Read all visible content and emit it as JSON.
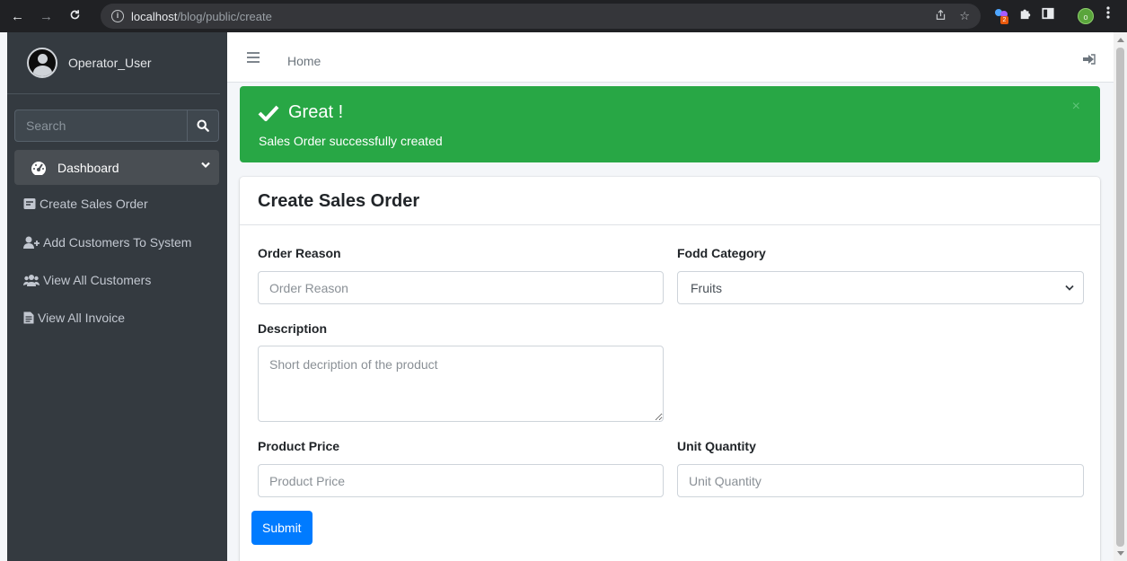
{
  "browser": {
    "url_host": "localhost",
    "url_path": "/blog/public/create",
    "extension_badge": "2",
    "profile_initial": "o"
  },
  "sidebar": {
    "user_name": "Operator_User",
    "search_placeholder": "Search",
    "dashboard_label": "Dashboard",
    "items": [
      {
        "label": "Create Sales Order",
        "icon": "form-icon"
      },
      {
        "label": "Add Customers To System",
        "icon": "user-plus-icon"
      },
      {
        "label": "View All Customers",
        "icon": "users-icon"
      },
      {
        "label": "View All Invoice",
        "icon": "file-invoice-icon"
      }
    ]
  },
  "topnav": {
    "home_label": "Home"
  },
  "alert": {
    "title": "Great !",
    "message": "Sales Order successfully created",
    "close": "×",
    "color": "#28a745"
  },
  "form": {
    "title": "Create Sales Order",
    "order_reason": {
      "label": "Order Reason",
      "placeholder": "Order Reason"
    },
    "food_category": {
      "label": "Fodd Category",
      "value": "Fruits"
    },
    "description": {
      "label": "Description",
      "placeholder": "Short decription of the product"
    },
    "product_price": {
      "label": "Product Price",
      "placeholder": "Product Price"
    },
    "unit_quantity": {
      "label": "Unit Quantity",
      "placeholder": "Unit Quantity"
    },
    "submit_label": "Submit",
    "submit_color": "#007bff"
  }
}
